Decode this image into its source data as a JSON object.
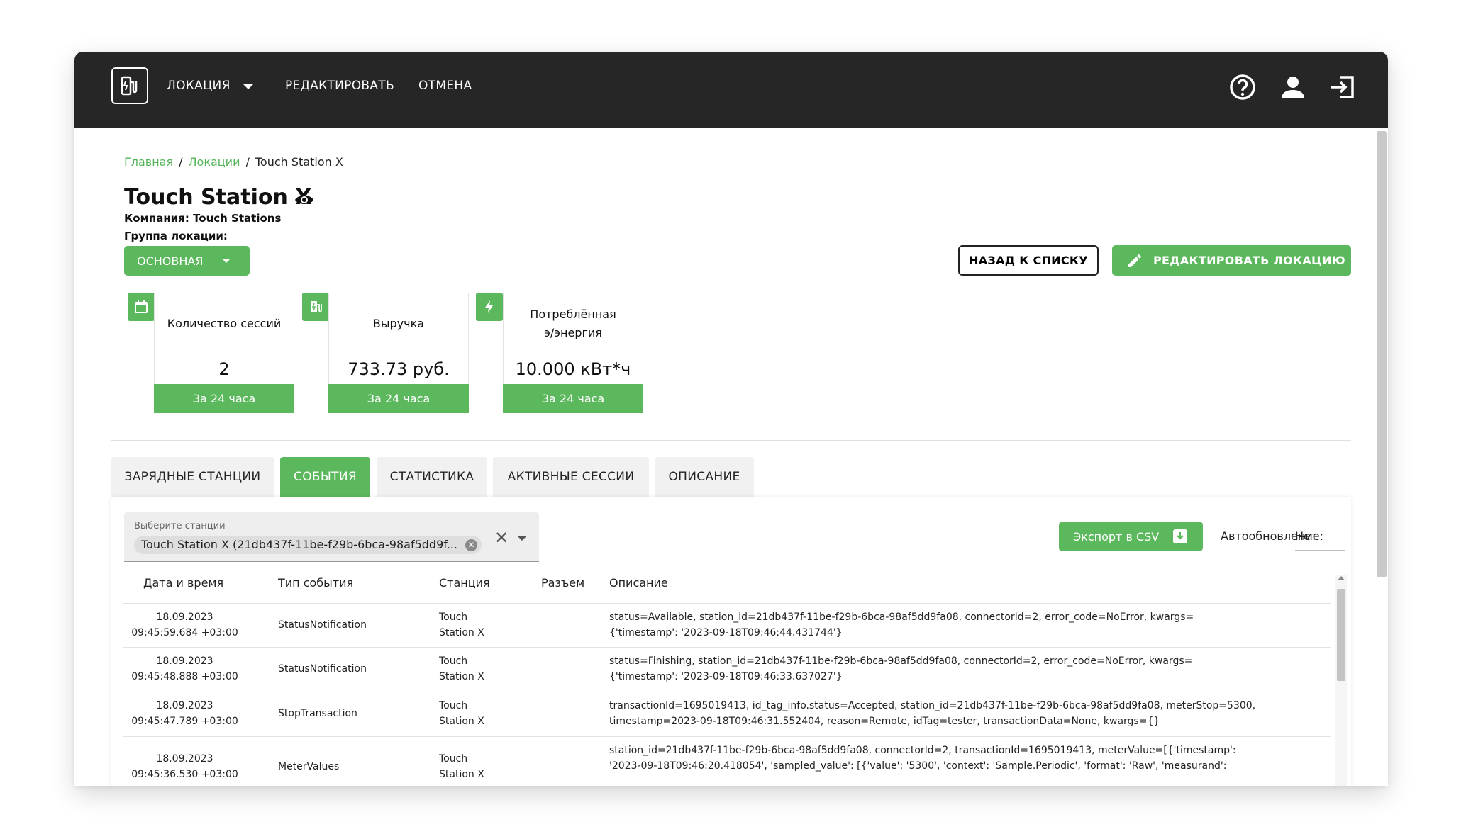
{
  "nav": {
    "location": "ЛОКАЦИЯ",
    "edit": "РЕДАКТИРОВАТЬ",
    "cancel": "ОТМЕНА"
  },
  "breadcrumb": {
    "home": "Главная",
    "locations": "Локации",
    "current": "Touch Station X"
  },
  "header": {
    "title": "Touch Station X",
    "company": "Компания: Touch Stations",
    "group_label": "Группа локации:",
    "group_value": "ОСНОВНАЯ"
  },
  "actions": {
    "back": "НАЗАД К СПИСКУ",
    "edit_location": "РЕДАКТИРОВАТЬ ЛОКАЦИЮ"
  },
  "cards": [
    {
      "title": "Количество сессий",
      "value": "2",
      "footer": "За 24 часа",
      "icon": "calendar-icon"
    },
    {
      "title": "Выручка",
      "value": "733.73 руб.",
      "footer": "За 24 часа",
      "icon": "station-icon"
    },
    {
      "title_line1": "Потреблённая",
      "title_line2": "э/энергия",
      "value": "10.000 кВт*ч",
      "footer": "За 24 часа",
      "icon": "bolt-icon"
    }
  ],
  "tabs": [
    "ЗАРЯДНЫЕ СТАНЦИИ",
    "СОБЫТИЯ",
    "СТАТИСТИКА",
    "АКТИВНЫЕ СЕССИИ",
    "ОПИСАНИЕ"
  ],
  "active_tab": "СОБЫТИЯ",
  "filter": {
    "label": "Выберите станции",
    "chip": "Touch Station X (21db437f-11be-f29b-6bca-98af5dd9f..."
  },
  "export_label": "Экспорт в CSV",
  "auto_refresh": {
    "label": "Автообновление:",
    "value": "Нет"
  },
  "table": {
    "columns": [
      "Дата и время",
      "Тип события",
      "Станция",
      "Разъем",
      "Описание"
    ],
    "rows": [
      {
        "date": "18.09.2023",
        "time": "09:45:59.684 +03:00",
        "type": "StatusNotification",
        "station1": "Touch",
        "station2": "Station X",
        "desc1": "status=Available, station_id=21db437f-11be-f29b-6bca-98af5dd9fa08, connectorId=2, error_code=NoError, kwargs=",
        "desc2": "{'timestamp': '2023-09-18T09:46:44.431744'}"
      },
      {
        "date": "18.09.2023",
        "time": "09:45:48.888 +03:00",
        "type": "StatusNotification",
        "station1": "Touch",
        "station2": "Station X",
        "desc1": "status=Finishing, station_id=21db437f-11be-f29b-6bca-98af5dd9fa08, connectorId=2, error_code=NoError, kwargs=",
        "desc2": "{'timestamp': '2023-09-18T09:46:33.637027'}"
      },
      {
        "date": "18.09.2023",
        "time": "09:45:47.789 +03:00",
        "type": "StopTransaction",
        "station1": "Touch",
        "station2": "Station X",
        "desc1": "transactionId=1695019413, id_tag_info.status=Accepted, station_id=21db437f-11be-f29b-6bca-98af5dd9fa08, meterStop=5300,",
        "desc2": "timestamp=2023-09-18T09:46:31.552404, reason=Remote, idTag=tester, transactionData=None, kwargs={}"
      },
      {
        "date": "18.09.2023",
        "time": "09:45:36.530 +03:00",
        "type": "MeterValues",
        "station1": "Touch",
        "station2": "Station X",
        "desc1": "station_id=21db437f-11be-f29b-6bca-98af5dd9fa08, connectorId=2, transactionId=1695019413, meterValue=[{'timestamp':",
        "desc2": "'2023-09-18T09:46:20.418054', 'sampled_value': [{'value': '5300', 'context': 'Sample.Periodic', 'format': 'Raw', 'measurand':"
      }
    ]
  },
  "colors": {
    "accent": "#5cb85c",
    "topbar": "#262626"
  }
}
